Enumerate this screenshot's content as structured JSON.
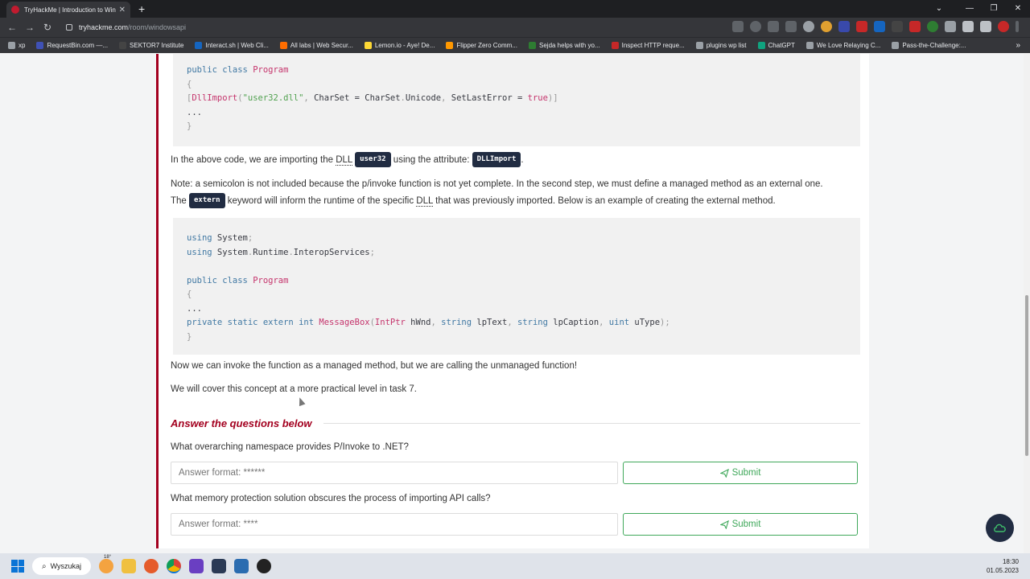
{
  "browser": {
    "tab_title": "TryHackMe | Introduction to Win",
    "url_host": "tryhackme.com",
    "url_path": "/room/windowsapi",
    "bookmarks": [
      {
        "label": "xp",
        "color": "#9aa0a6"
      },
      {
        "label": "RequestBin.com —...",
        "color": "#3f51b5"
      },
      {
        "label": "SEKTOR7 Institute",
        "color": "#444"
      },
      {
        "label": "Interact.sh | Web Cli...",
        "color": "#1565c0"
      },
      {
        "label": "All labs | Web Secur...",
        "color": "#ff6d00"
      },
      {
        "label": "Lemon.io - Aye! De...",
        "color": "#fdd835"
      },
      {
        "label": "Flipper Zero Comm...",
        "color": "#ff9800"
      },
      {
        "label": "Sejda helps with yo...",
        "color": "#2e7d32"
      },
      {
        "label": "Inspect HTTP reque...",
        "color": "#c62828"
      },
      {
        "label": "plugins wp list",
        "color": "#9aa0a6"
      },
      {
        "label": "ChatGPT",
        "color": "#10a37f"
      },
      {
        "label": "We Love Relaying C...",
        "color": "#9aa0a6"
      },
      {
        "label": "Pass-the-Challenge:...",
        "color": "#9aa0a6"
      }
    ]
  },
  "content": {
    "code1": [
      "public class Program",
      "{",
      "[DllImport(\"user32.dll\", CharSet = CharSet.Unicode, SetLastError = true)]",
      "...",
      "}"
    ],
    "p1_before": "In the above code, we are importing the ",
    "p1_dll": "DLL",
    "p1_chip1": "user32",
    "p1_mid": " using the attribute: ",
    "p1_chip2": "DLLImport",
    "p1_end": ".",
    "p2_line1": "Note: a semicolon is not included because the p/invoke function is not yet complete. In the second step, we must define a managed method as an external one.",
    "p2_the": "The ",
    "p2_chip": "extern",
    "p2_rest1": " keyword will inform the runtime of the specific ",
    "p2_dll": "DLL",
    "p2_rest2": " that was previously imported. Below is an example of creating the external method.",
    "p3": "Now we can invoke the function as a managed method, but we are calling the unmanaged function!",
    "p4": "We will cover this concept at a more practical level in task 7."
  },
  "answers": {
    "heading": "Answer the questions below",
    "questions": [
      {
        "text": "What overarching namespace provides P/Invoke to .NET?",
        "placeholder": "Answer format: ******",
        "submit": "Submit"
      },
      {
        "text": "What memory protection solution obscures the process of importing API calls?",
        "placeholder": "Answer format: ****",
        "submit": "Submit"
      }
    ]
  },
  "taskbar": {
    "search_label": "Wyszukaj",
    "weather_badge": "18°",
    "time": "18:30",
    "date": "01.05.2023"
  }
}
